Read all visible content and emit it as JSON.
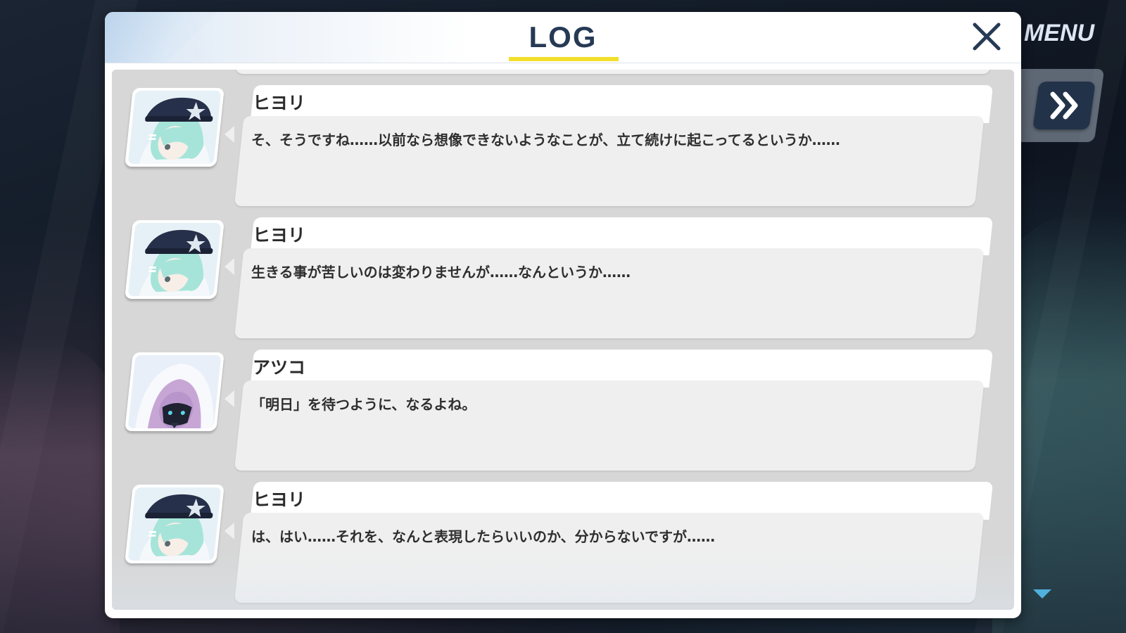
{
  "hud": {
    "menu_label": "MENU",
    "fast_forward_icon": "double-chevron-right-icon"
  },
  "log_window": {
    "title": "LOG",
    "close_icon": "close-x-icon",
    "accent_color": "#f2df2b",
    "title_color": "#263a55",
    "entries": [
      {
        "speaker": "ヒヨリ",
        "text": "そ、そうですね……以前なら想像できないようなことが、立て続けに起こってるというか……",
        "avatar": "hiyori-portrait"
      },
      {
        "speaker": "ヒヨリ",
        "text": "生きる事が苦しいのは変わりませんが……なんというか……",
        "avatar": "hiyori-portrait"
      },
      {
        "speaker": "アツコ",
        "text": "「明日」を待つように、なるよね。",
        "avatar": "atsuko-portrait"
      },
      {
        "speaker": "ヒヨリ",
        "text": "は、はい……それを、なんと表現したらいいのか、分からないですが……",
        "avatar": "hiyori-portrait"
      }
    ]
  },
  "scroll_indicator": "scroll-down-arrow-icon"
}
